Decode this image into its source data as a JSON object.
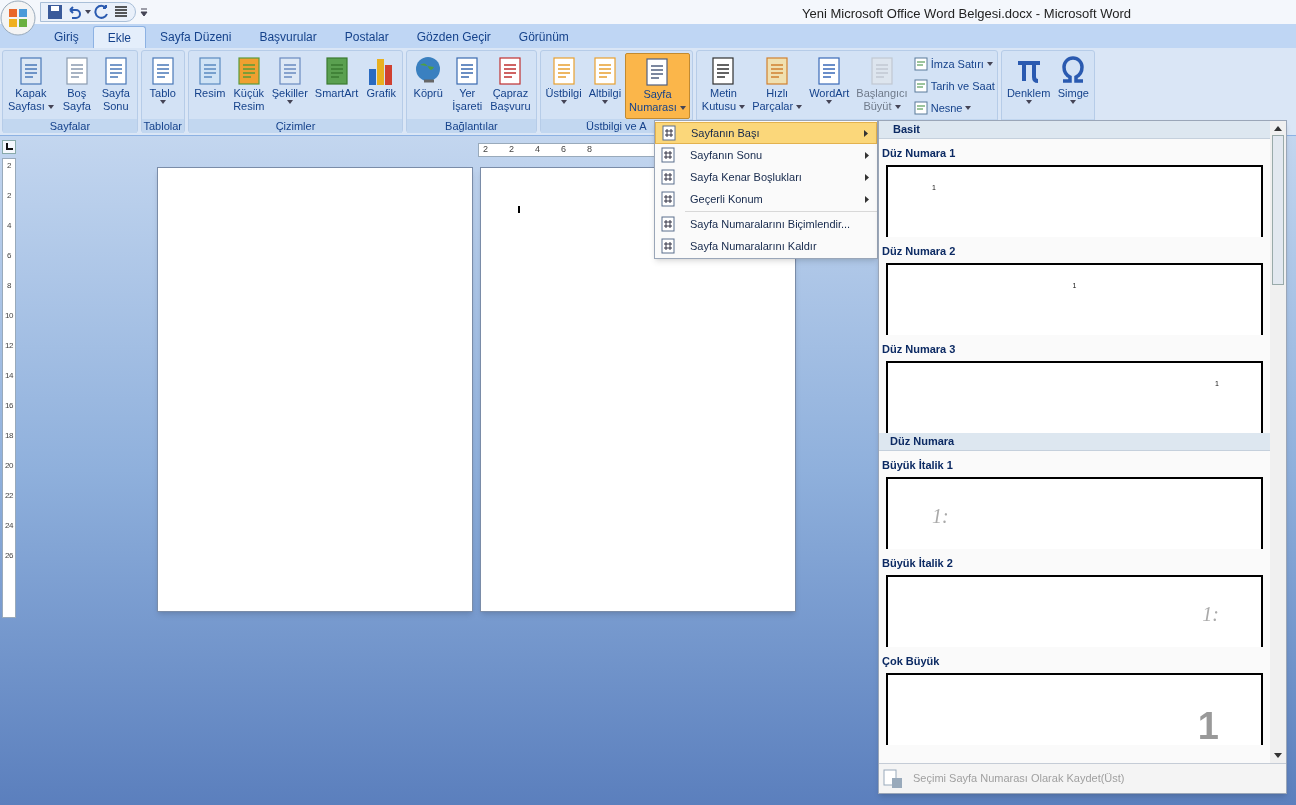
{
  "window": {
    "title": "Yeni Microsoft Office Word Belgesi.docx - Microsoft Word"
  },
  "tabs": [
    {
      "label": "Giriş",
      "selected": false
    },
    {
      "label": "Ekle",
      "selected": true
    },
    {
      "label": "Sayfa Düzeni",
      "selected": false
    },
    {
      "label": "Başvurular",
      "selected": false
    },
    {
      "label": "Postalar",
      "selected": false
    },
    {
      "label": "Gözden Geçir",
      "selected": false
    },
    {
      "label": "Görünüm",
      "selected": false
    }
  ],
  "ribbon_groups": [
    {
      "label": "Sayfalar",
      "buttons": [
        {
          "lines": [
            "Kapak",
            "Sayfası"
          ],
          "dropdown": true,
          "pressed": false,
          "disabled": false
        },
        {
          "lines": [
            "Boş",
            "Sayfa"
          ],
          "dropdown": false,
          "pressed": false,
          "disabled": false
        },
        {
          "lines": [
            "Sayfa",
            "Sonu"
          ],
          "dropdown": false,
          "pressed": false,
          "disabled": false
        }
      ]
    },
    {
      "label": "Tablolar",
      "buttons": [
        {
          "lines": [
            "Tablo"
          ],
          "dropdown": true,
          "pressed": false,
          "disabled": false
        }
      ]
    },
    {
      "label": "Çizimler",
      "buttons": [
        {
          "lines": [
            "Resim"
          ],
          "dropdown": false,
          "pressed": false,
          "disabled": false
        },
        {
          "lines": [
            "Küçük",
            "Resim"
          ],
          "dropdown": false,
          "pressed": false,
          "disabled": false
        },
        {
          "lines": [
            "Şekiller"
          ],
          "dropdown": true,
          "pressed": false,
          "disabled": false
        },
        {
          "lines": [
            "SmartArt"
          ],
          "dropdown": false,
          "pressed": false,
          "disabled": false
        },
        {
          "lines": [
            "Grafik"
          ],
          "dropdown": false,
          "pressed": false,
          "disabled": false
        }
      ]
    },
    {
      "label": "Bağlantılar",
      "buttons": [
        {
          "lines": [
            "Köprü"
          ],
          "dropdown": false,
          "pressed": false,
          "disabled": false
        },
        {
          "lines": [
            "Yer",
            "İşareti"
          ],
          "dropdown": false,
          "pressed": false,
          "disabled": false
        },
        {
          "lines": [
            "Çapraz",
            "Başvuru"
          ],
          "dropdown": false,
          "pressed": false,
          "disabled": false
        }
      ]
    },
    {
      "label": "Üstbilgi ve A",
      "buttons": [
        {
          "lines": [
            "Üstbilgi"
          ],
          "dropdown": true,
          "pressed": false,
          "disabled": false
        },
        {
          "lines": [
            "Altbilgi"
          ],
          "dropdown": true,
          "pressed": false,
          "disabled": false
        },
        {
          "lines": [
            "Sayfa",
            "Numarası"
          ],
          "dropdown": true,
          "pressed": true,
          "disabled": false
        }
      ]
    },
    {
      "buttons": [
        {
          "lines": [
            "Metin",
            "Kutusu"
          ],
          "dropdown": true,
          "pressed": false,
          "disabled": false
        },
        {
          "lines": [
            "Hızlı",
            "Parçalar"
          ],
          "dropdown": true,
          "pressed": false,
          "disabled": false
        },
        {
          "lines": [
            "WordArt"
          ],
          "dropdown": true,
          "pressed": false,
          "disabled": false
        },
        {
          "lines": [
            "Başlangıcı",
            "Büyüt"
          ],
          "dropdown": true,
          "pressed": false,
          "disabled": true
        }
      ],
      "small_buttons": [
        {
          "label": "İmza Satırı",
          "dropdown": true
        },
        {
          "label": "Tarih ve Saat",
          "dropdown": false
        },
        {
          "label": "Nesne",
          "dropdown": true
        }
      ]
    },
    {
      "buttons": [
        {
          "lines": [
            "Denklem"
          ],
          "dropdown": true,
          "pressed": false,
          "disabled": false
        },
        {
          "lines": [
            "Simge"
          ],
          "dropdown": true,
          "pressed": false,
          "disabled": false
        }
      ]
    }
  ],
  "ruler": {
    "horizontal": [
      "2",
      "2",
      "4",
      "6",
      "8"
    ],
    "vertical": [
      "2",
      "2",
      "4",
      "6",
      "8",
      "10",
      "12",
      "14",
      "16",
      "18",
      "20",
      "22",
      "24",
      "26"
    ]
  },
  "pages": [
    {
      "cursor": false
    },
    {
      "cursor": true
    }
  ],
  "menu": {
    "items": [
      {
        "label": "Sayfanın Başı",
        "submenu": true,
        "selected": true
      },
      {
        "label": "Sayfanın Sonu",
        "submenu": true,
        "selected": false
      },
      {
        "label": "Sayfa Kenar Boşlukları",
        "submenu": true,
        "selected": false
      },
      {
        "label": "Geçerli Konum",
        "submenu": true,
        "selected": false
      },
      {
        "label": "Sayfa Numaralarını Biçimlendir...",
        "submenu": false,
        "selected": false
      },
      {
        "label": "Sayfa Numaralarını Kaldır",
        "submenu": false,
        "selected": false
      }
    ]
  },
  "gallery": {
    "sections": [
      {
        "heading": "Basit",
        "items": [
          {
            "label": "Düz Numara 1",
            "preview": "1",
            "kind": "small-left"
          },
          {
            "label": "Düz Numara 2",
            "preview": "1",
            "kind": "small-center"
          },
          {
            "label": "Düz Numara 3",
            "preview": "1",
            "kind": "small-right"
          }
        ]
      },
      {
        "heading": "Düz Numara",
        "items": [
          {
            "label": "Büyük İtalik 1",
            "preview": "1:",
            "kind": "italic-left"
          },
          {
            "label": "Büyük İtalik 2",
            "preview": "1:",
            "kind": "italic-right"
          },
          {
            "label": "Çok Büyük",
            "preview": "1",
            "kind": "large-right"
          }
        ]
      }
    ],
    "footer": {
      "label": "Seçimi Sayfa Numarası Olarak Kaydet(Üst)",
      "disabled": true
    }
  }
}
